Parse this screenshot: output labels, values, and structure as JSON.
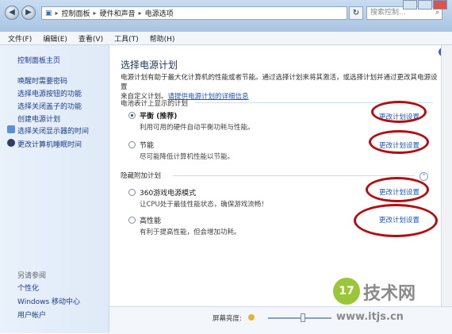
{
  "addressbar": {
    "crumbs": [
      "控制面板",
      "硬件和声音",
      "电源选项"
    ]
  },
  "search": {
    "placeholder": "搜索控制..."
  },
  "menu": [
    "文件(F)",
    "编辑(E)",
    "查看(V)",
    "工具(T)",
    "帮助(H)"
  ],
  "sidebar": {
    "home": "控制面板主页",
    "items": [
      "唤醒时需要密码",
      "选择电源按钮的功能",
      "选择关闭盖子的功能",
      "创建电源计划",
      "选择关闭显示器的时间",
      "更改计算机睡眠时间"
    ],
    "see_also": "另请参阅",
    "see_also_items": [
      "个性化",
      "Windows 移动中心",
      "用户帐户"
    ]
  },
  "main": {
    "heading": "选择电源计划",
    "desc_line1": "电源计划有助于最大化计算机的性能或者节能。通过选择计划来将其激活，或选择计划并通过更改其电源设置",
    "desc_line2_prefix": "来自定义计划。",
    "desc_link": "请提供电源计划的详细信息",
    "section1": "电池表计上显示的计划",
    "section2": "隐藏附加计划",
    "plans": [
      {
        "name": "平衡 (推荐)",
        "desc": "利用可用的硬件自动平衡功耗与性能。",
        "link": "更改计划设置",
        "selected": true
      },
      {
        "name": "节能",
        "desc": "尽可能降低计算机性能以节能。",
        "link": "更改计划设置",
        "selected": false
      },
      {
        "name": "360游戏电源模式",
        "desc": "让CPU处于最佳性能状态，确保游戏流畅！",
        "link": "更改计划设置",
        "selected": false
      },
      {
        "name": "高性能",
        "desc": "有利于提高性能，但会增加功耗。",
        "link": "更改计划设置",
        "selected": false
      }
    ]
  },
  "status": {
    "brightness_label": "屏幕亮度:",
    "brightness_level": 0.55
  },
  "watermark": {
    "logo": "17",
    "name": "技术网",
    "url": "www.itjs.cn"
  },
  "colors": {
    "annotation_oval": "#b30d12",
    "link": "#1a55c0",
    "sidebar_link": "#1a3c8a"
  }
}
